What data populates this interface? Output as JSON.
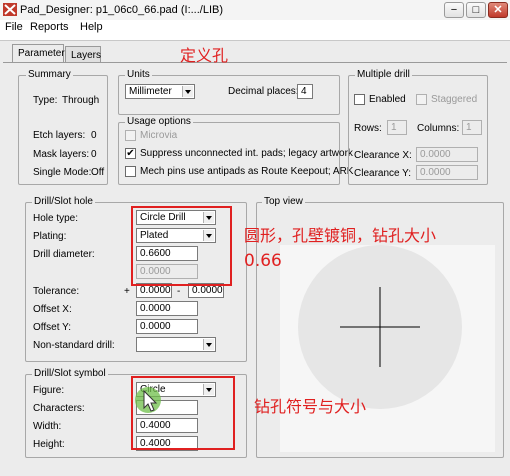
{
  "window": {
    "title": "Pad_Designer: p1_06c0_66.pad (I:.../LIB)",
    "min_label": "−",
    "max_label": "□",
    "close_label": "✕"
  },
  "menu": [
    "File",
    "Reports",
    "Help"
  ],
  "tabs": [
    "Parameters",
    "Layers"
  ],
  "summary": {
    "title": "Summary",
    "type_label": "Type:",
    "type_value": "Through",
    "etch_label": "Etch layers:",
    "etch_value": "0",
    "mask_label": "Mask layers:",
    "mask_value": "0",
    "single_label": "Single Mode:",
    "single_value": "Off"
  },
  "units": {
    "title": "Units",
    "unit_value": "Millimeter",
    "decimal_label": "Decimal places:",
    "decimal_value": "4"
  },
  "usage": {
    "title": "Usage options",
    "microvia": "Microvia",
    "suppress": "Suppress unconnected int. pads; legacy artwork",
    "mech": "Mech pins use antipads as Route Keepout; ARK"
  },
  "multiple_drill": {
    "title": "Multiple drill",
    "enabled": "Enabled",
    "staggered": "Staggered",
    "rows_label": "Rows:",
    "rows_value": "1",
    "cols_label": "Columns:",
    "cols_value": "1",
    "clearx_label": "Clearance X:",
    "clearx_value": "0.0000",
    "cleary_label": "Clearance Y:",
    "cleary_value": "0.0000"
  },
  "drill_hole": {
    "title": "Drill/Slot hole",
    "hole_type_label": "Hole type:",
    "hole_type_value": "Circle Drill",
    "plating_label": "Plating:",
    "plating_value": "Plated",
    "diameter_label": "Drill diameter:",
    "diameter_value": "0.6600",
    "diameter2_value": "0.0000",
    "tolerance_label": "Tolerance:",
    "tol_plus": "+",
    "tol_plus_value": "0.0000",
    "tol_minus": "-",
    "tol_minus_value": "0.0000",
    "offsetx_label": "Offset X:",
    "offsetx_value": "0.0000",
    "offsety_label": "Offset Y:",
    "offsety_value": "0.0000",
    "nonstd_label": "Non-standard drill:",
    "nonstd_value": ""
  },
  "drill_symbol": {
    "title": "Drill/Slot symbol",
    "figure_label": "Figure:",
    "figure_value": "Circle",
    "chars_label": "Characters:",
    "chars_value": "",
    "width_label": "Width:",
    "width_value": "0.4000",
    "height_label": "Height:",
    "height_value": "0.4000"
  },
  "top_view": {
    "title": "Top view"
  },
  "annotations": {
    "define_hole": "定义孔",
    "hole_desc": "圆形，孔壁镀铜，钻孔大小",
    "hole_size": "0.66",
    "symbol_desc": "钻孔符号与大小"
  },
  "colors": {
    "annotation": "#e02020",
    "panel": "#ececec",
    "topview_circle": "#e6e6e6"
  }
}
